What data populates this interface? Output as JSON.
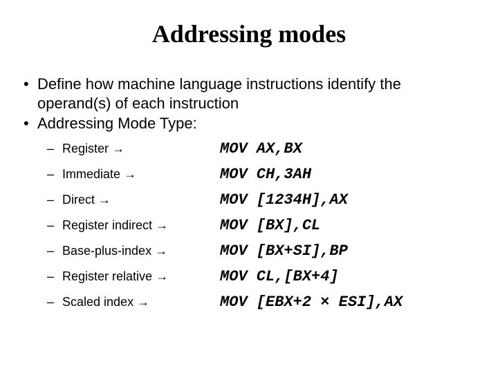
{
  "title": "Addressing modes",
  "bullets": {
    "b1": "Define how machine language instructions identify the operand(s) of each instruction",
    "b2": "Addressing Mode Type:"
  },
  "arrow": "→",
  "modes": [
    {
      "label": "Register",
      "code": "MOV AX,BX"
    },
    {
      "label": "Immediate",
      "code": "MOV CH,3AH"
    },
    {
      "label": "Direct",
      "code": "MOV [1234H],AX"
    },
    {
      "label": "Register indirect",
      "code": "MOV [BX],CL"
    },
    {
      "label": "Base-plus-index",
      "code": "MOV [BX+SI],BP"
    },
    {
      "label": "Register relative",
      "code": "MOV CL,[BX+4]"
    },
    {
      "label": "Scaled index",
      "code": "MOV [EBX+2 × ESI],AX"
    }
  ]
}
